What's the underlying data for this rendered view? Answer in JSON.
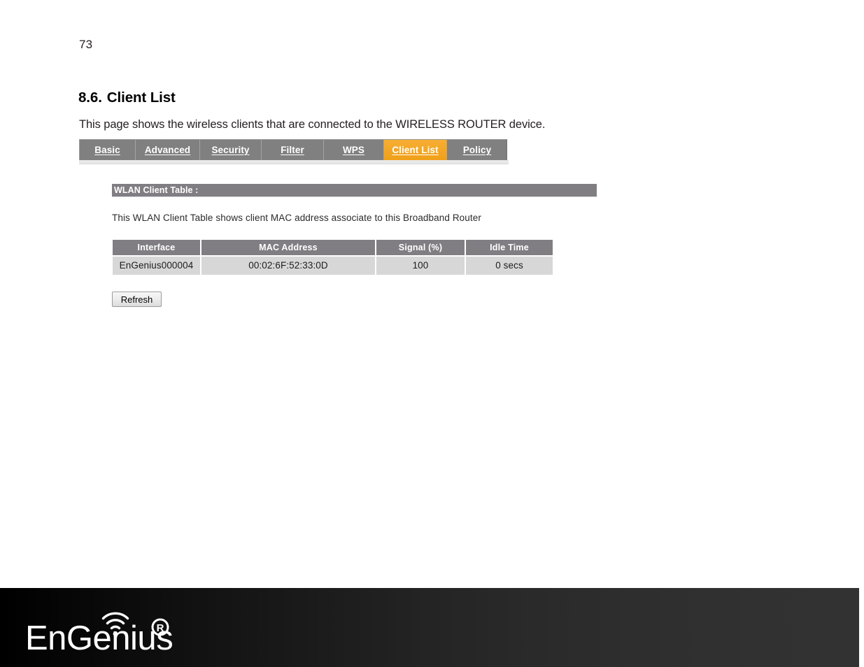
{
  "document": {
    "page_number": "73",
    "section_number": "8.6.",
    "section_title": "Client List",
    "intro_text": "This page shows the wireless clients that are connected to the WIRELESS ROUTER device."
  },
  "router_ui": {
    "tabs": [
      {
        "label": "Basic",
        "active": false
      },
      {
        "label": "Advanced",
        "active": false
      },
      {
        "label": "Security",
        "active": false
      },
      {
        "label": "Filter",
        "active": false
      },
      {
        "label": "WPS",
        "active": false
      },
      {
        "label": "Client List",
        "active": true
      },
      {
        "label": "Policy",
        "active": false
      }
    ],
    "section_bar_title": "WLAN Client Table :",
    "section_description": "This WLAN Client Table shows client MAC address associate to this Broadband Router",
    "table": {
      "headers": [
        "Interface",
        "MAC Address",
        "Signal (%)",
        "Idle Time"
      ],
      "rows": [
        [
          "EnGenius000004",
          "00:02:6F:52:33:0D",
          "100",
          "0 secs"
        ]
      ]
    },
    "refresh_label": "Refresh",
    "colors": {
      "tab_bar_background": "#808080",
      "active_tab_background": "#f5a623",
      "table_header_background": "#807e83",
      "table_row_background": "#d7d7d7"
    }
  },
  "footer": {
    "brand": "EnGenius",
    "trademark": "®",
    "background_start": "#000000",
    "background_end": "#323232"
  }
}
